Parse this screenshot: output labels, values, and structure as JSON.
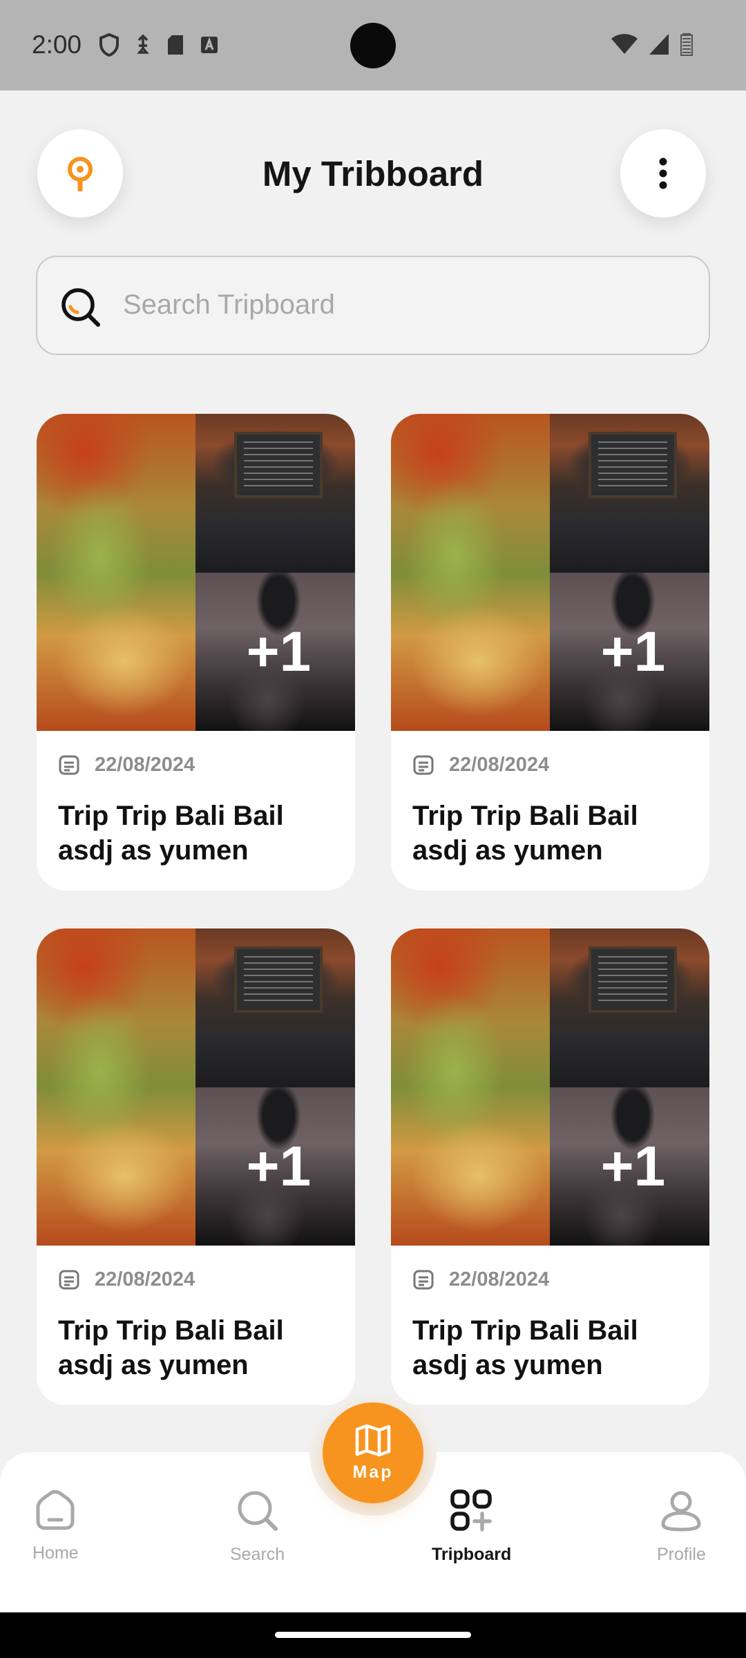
{
  "status_bar": {
    "time": "2:00"
  },
  "header": {
    "title": "My Tribboard"
  },
  "search": {
    "placeholder": "Search Tripboard",
    "value": ""
  },
  "cards": [
    {
      "date": "22/08/2024",
      "title": "Trip Trip Bali Bail asdj as yumen",
      "extra_images": "+1"
    },
    {
      "date": "22/08/2024",
      "title": "Trip Trip Bali Bail asdj as yumen",
      "extra_images": "+1"
    },
    {
      "date": "22/08/2024",
      "title": "Trip Trip Bali Bail asdj as yumen",
      "extra_images": "+1"
    },
    {
      "date": "22/08/2024",
      "title": "Trip Trip Bali Bail asdj as yumen",
      "extra_images": "+1"
    }
  ],
  "bottom_nav": {
    "map_label": "Map",
    "items": [
      {
        "label": "Home",
        "icon": "home-icon",
        "active": false
      },
      {
        "label": "Search",
        "icon": "search-icon",
        "active": false
      },
      {
        "label": "Tripboard",
        "icon": "tripboard-icon",
        "active": true
      },
      {
        "label": "Profile",
        "icon": "profile-icon",
        "active": false
      }
    ]
  },
  "colors": {
    "accent": "#f7941f",
    "background": "#f1f1f1",
    "text": "#151515",
    "muted": "#a9a9a9"
  }
}
